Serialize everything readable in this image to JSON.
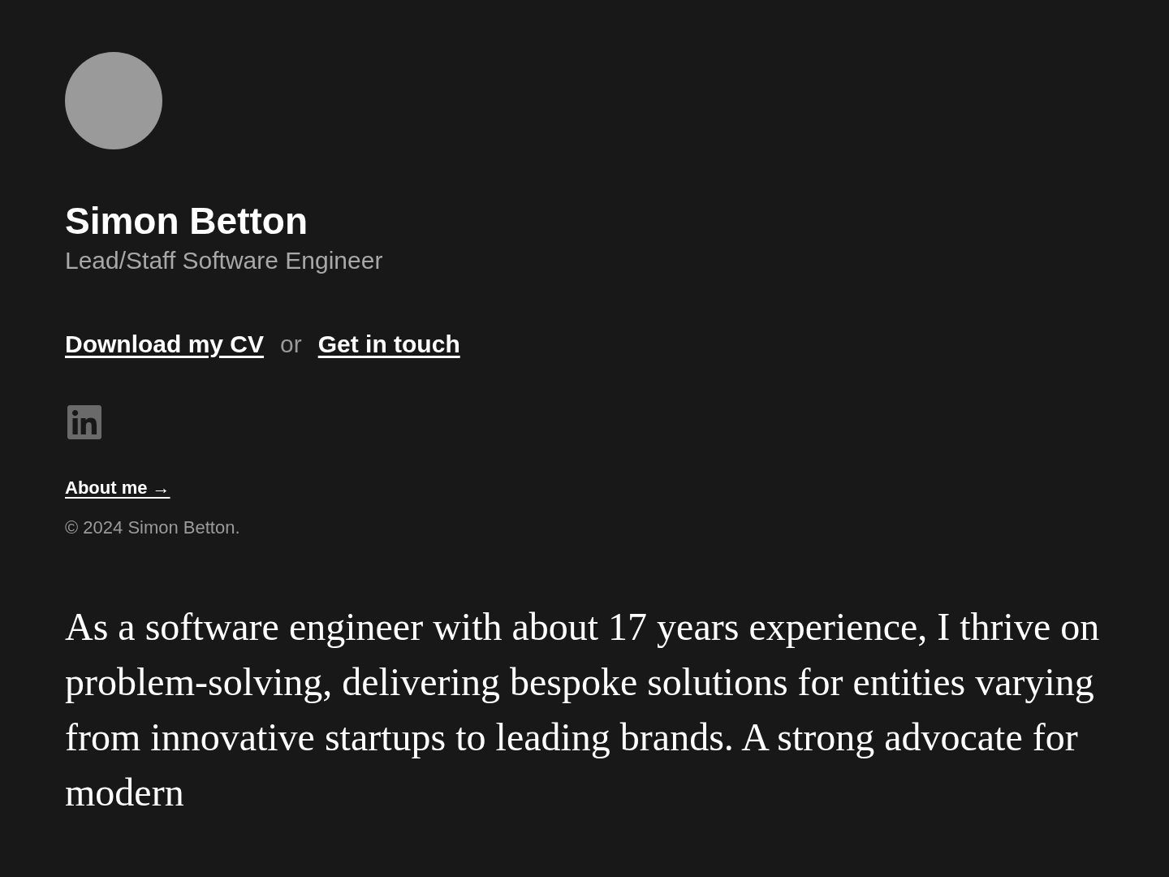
{
  "profile": {
    "name": "Simon Betton",
    "role": "Lead/Staff Software Engineer"
  },
  "actions": {
    "primary": "Download my CV",
    "separator": "or",
    "secondary": "Get in touch"
  },
  "about_link": "About me →",
  "copyright": "© 2024 Simon Betton.",
  "intro": "As a software engineer with about 17 years experience, I thrive on problem-solving, delivering bespoke solutions for entities varying from innovative startups to leading brands. A strong advocate for modern"
}
